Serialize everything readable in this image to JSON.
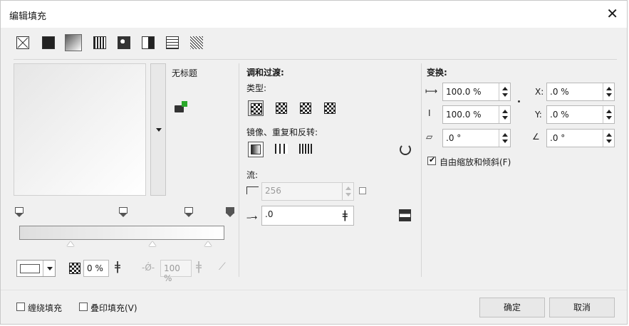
{
  "dialog": {
    "title": "编辑填充",
    "close_glyph": "✕"
  },
  "fill_types": [
    "no-fill-icon",
    "uniform-fill-icon",
    "fountain-fill-icon",
    "vector-pattern-icon",
    "bitmap-pattern-icon",
    "two-color-pattern-icon",
    "texture-fill-icon",
    "postscript-fill-icon"
  ],
  "preview": {
    "name": "无标题"
  },
  "transparency": {
    "value": "0 %"
  },
  "node_position": {
    "value": "100 %"
  },
  "blend": {
    "heading": "调和过渡:",
    "type_label": "类型:",
    "mirror_label": "镜像、重复和反转:",
    "flow_label": "流:",
    "steps": "256",
    "acceleration": ".0"
  },
  "transform": {
    "heading": "变换:",
    "width": "100.0 %",
    "height": "100.0 %",
    "x_label": "X:",
    "x": ".0 %",
    "y_label": "Y:",
    "y": ".0 %",
    "skew": ".0 °",
    "rotate": ".0 °",
    "free_scale_label": "自由缩放和倾斜(F)",
    "free_scale_checked": true
  },
  "footer": {
    "wrap_fill_label": "缠绕填充",
    "overprint_label": "叠印填充(V)",
    "ok_label": "确定",
    "cancel_label": "取消"
  }
}
